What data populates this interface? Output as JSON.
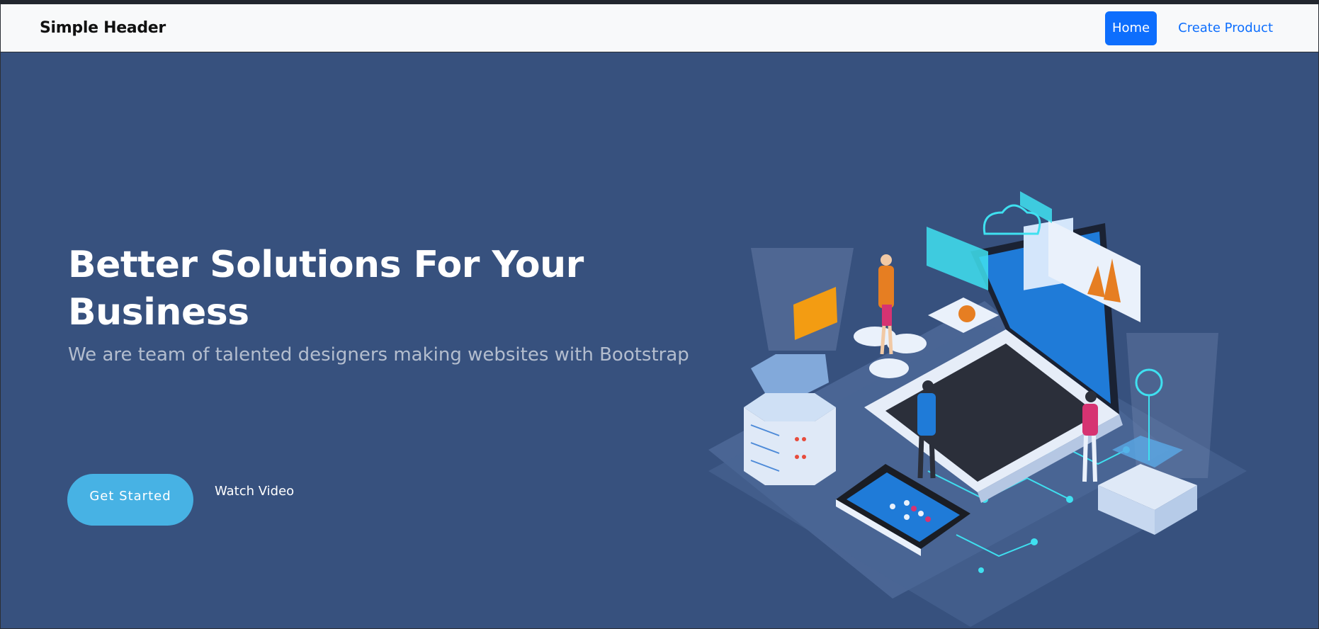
{
  "navbar": {
    "brand": "Simple Header",
    "links": [
      {
        "label": "Home",
        "active": true
      },
      {
        "label": "Create Product",
        "active": false
      }
    ]
  },
  "hero": {
    "title": "Better Solutions For Your Business",
    "subtitle": "We are team of talented designers making websites with Bootstrap",
    "primary_button": "Get Started",
    "secondary_link": "Watch Video",
    "illustration": "isometric-tech-illustration"
  },
  "colors": {
    "hero_background": "#37517e",
    "navbar_background": "#f8f9fa",
    "primary_blue": "#0d6efd",
    "cta_button": "#47b2e4"
  }
}
